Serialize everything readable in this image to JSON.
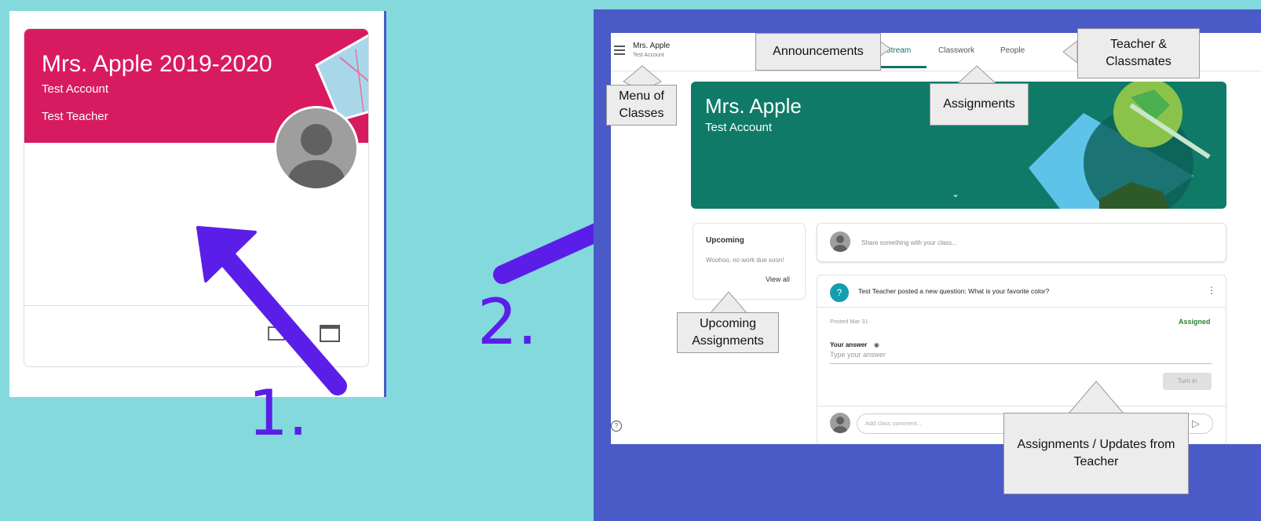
{
  "step_labels": {
    "one": "1.",
    "two": "2."
  },
  "class_card": {
    "title": "Mrs. Apple 2019-2020",
    "subtitle": "Test Account",
    "teacher": "Test Teacher",
    "header_color": "#d81b60",
    "footer_icons": [
      "assignments-icon",
      "folder-icon"
    ]
  },
  "classroom": {
    "class_name": "Mrs. Apple",
    "class_sub": "Test Account",
    "tabs": [
      {
        "label": "Stream",
        "active": true
      },
      {
        "label": "Classwork",
        "active": false
      },
      {
        "label": "People",
        "active": false
      }
    ],
    "banner": {
      "title": "Mrs. Apple",
      "subtitle": "Test Account",
      "color": "#0f7a68"
    },
    "upcoming": {
      "title": "Upcoming",
      "text": "Woohoo, no work due soon!",
      "view_all": "View all"
    },
    "share_placeholder": "Share something with your class...",
    "post": {
      "title": "Test Teacher posted a new question: What is your favorite color?",
      "date": "Posted Mar 31",
      "status": "Assigned",
      "answer_label": "Your answer",
      "answer_placeholder": "Type your answer",
      "turn_in": "Turn in",
      "comment_placeholder": "Add class comment..."
    }
  },
  "callouts": {
    "announcements": "Announcements",
    "teacher_classmates": "Teacher & Classmates",
    "menu_of_classes": "Menu of Classes",
    "assignments": "Assignments",
    "upcoming_assignments": "Upcoming Assignments",
    "updates": "Assignments / Updates from Teacher"
  },
  "colors": {
    "background": "#84d9dd",
    "arrow": "#5b1ee8",
    "frame": "#4a5bc8"
  }
}
